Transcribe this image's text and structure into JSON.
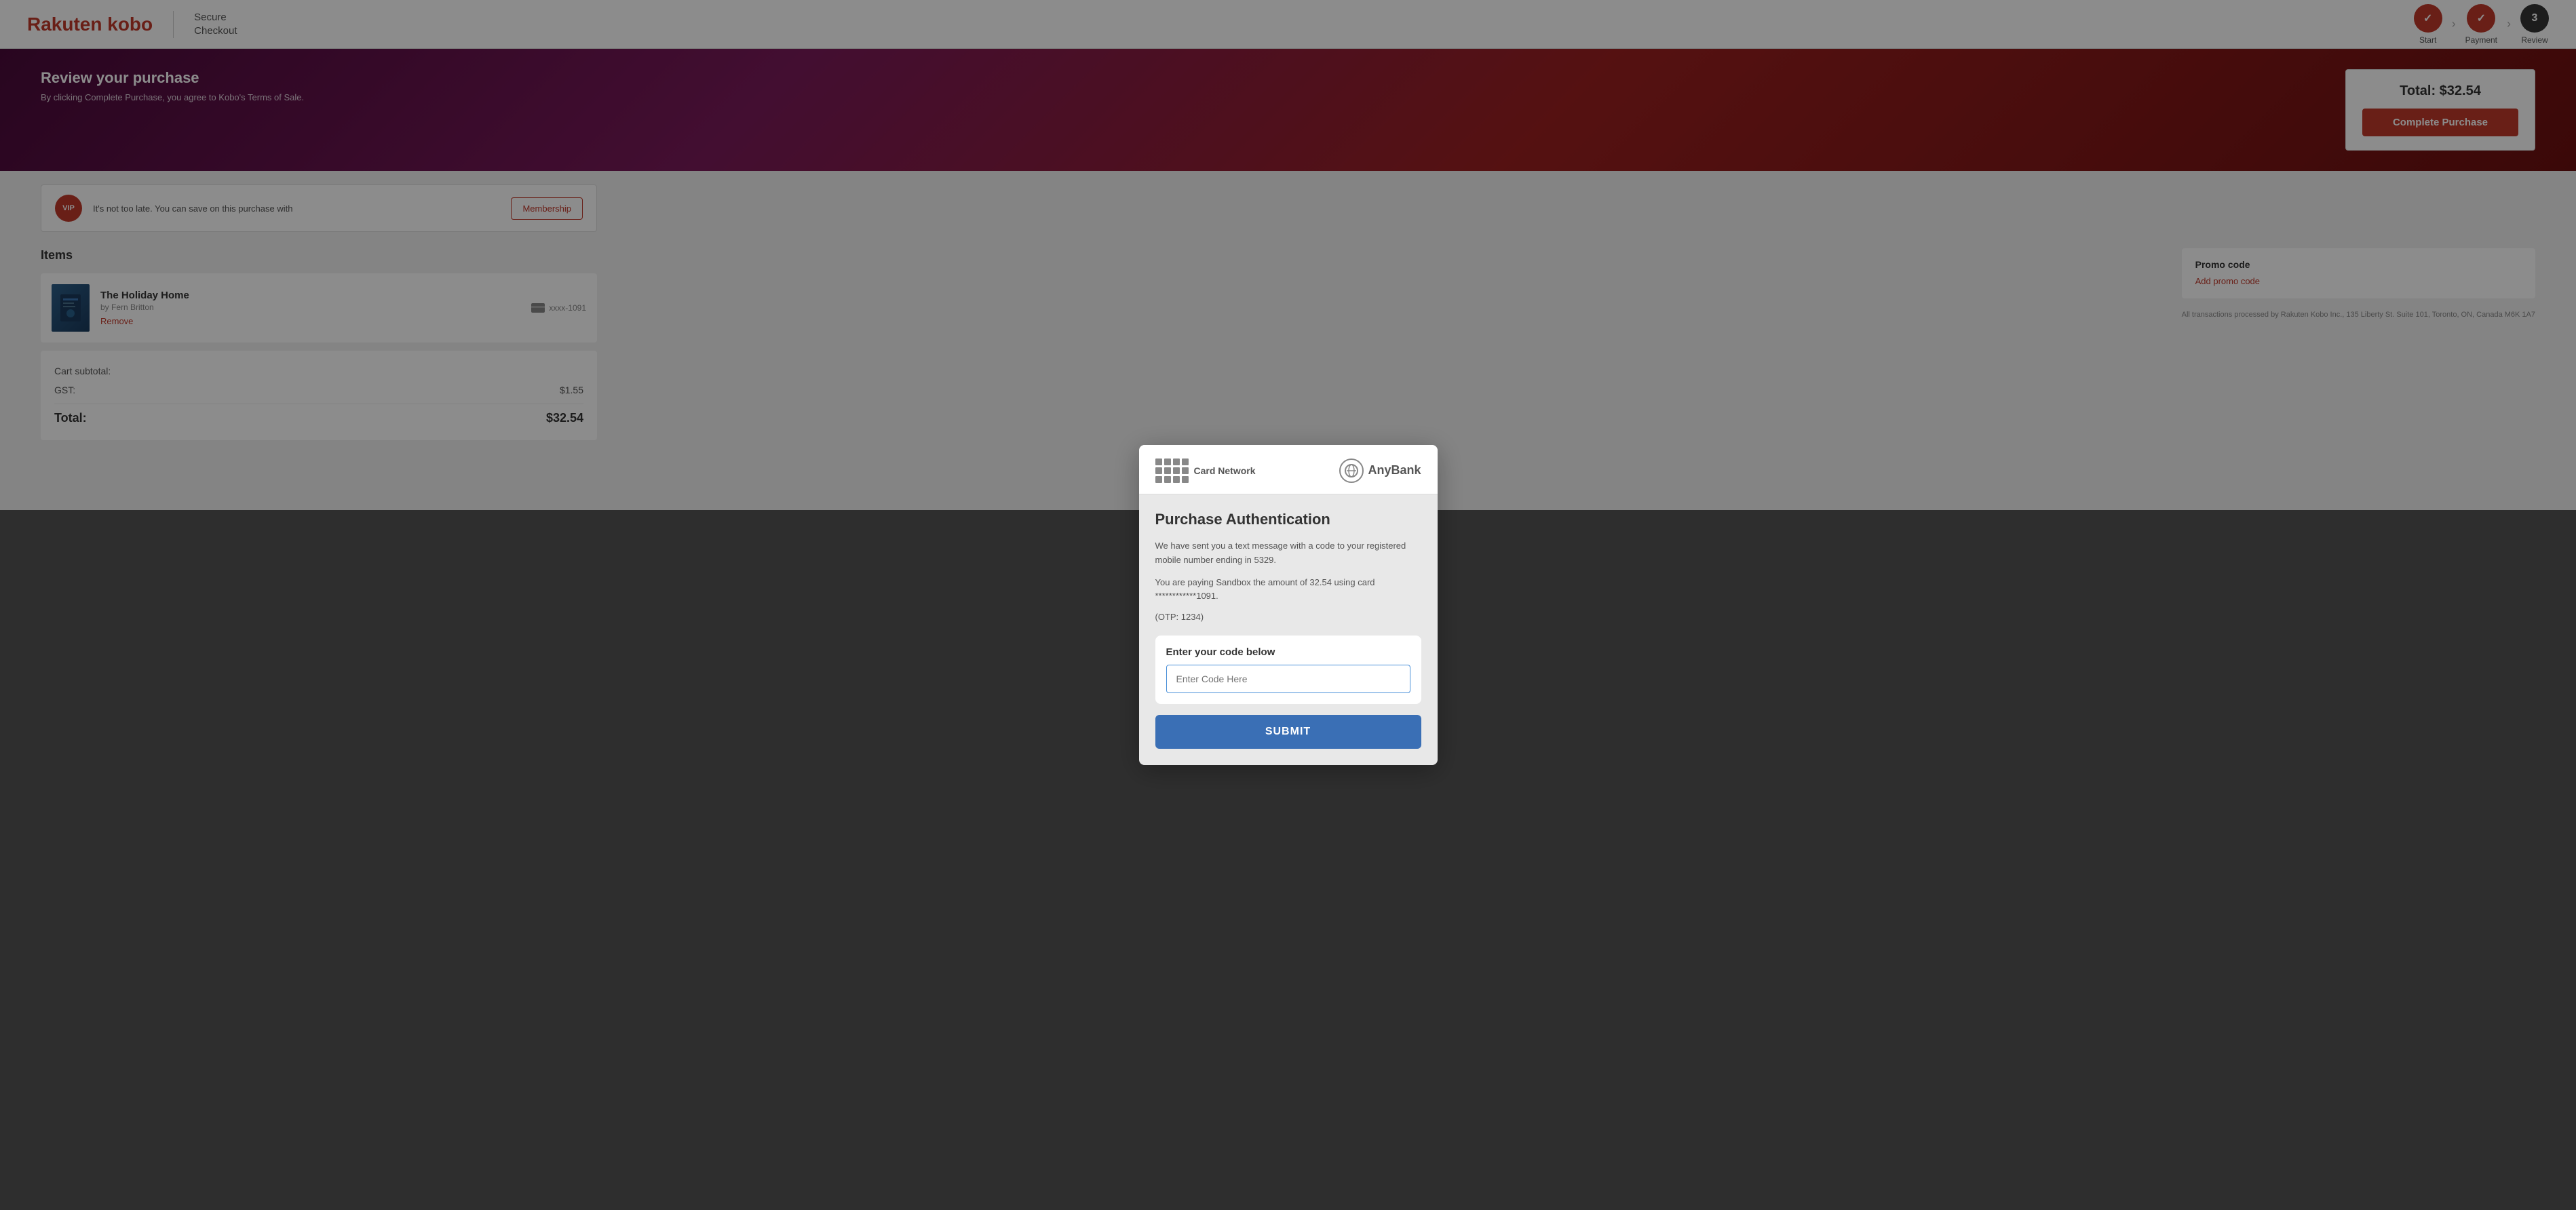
{
  "header": {
    "logo": "Rakuten kobo",
    "checkout_title": "Secure",
    "checkout_subtitle": "Checkout",
    "steps": [
      {
        "id": "start",
        "label": "Start",
        "state": "done",
        "number": "✓"
      },
      {
        "id": "payment",
        "label": "Payment",
        "state": "done",
        "number": "✓"
      },
      {
        "id": "review",
        "label": "Review",
        "state": "current",
        "number": "3"
      }
    ]
  },
  "hero": {
    "title": "Review your purchase",
    "subtitle": "By clicking Complete Purchase, you agree to Kobo's Terms of Sale.",
    "total_label": "Total: $32.54",
    "complete_btn": "Complete Purchase"
  },
  "vip": {
    "badge": "VIP",
    "text": "It's not too late. You can save on this purchase with",
    "btn": "Membership"
  },
  "items_section": {
    "title": "Items",
    "items": [
      {
        "id": "holiday-home",
        "title": "The Holiday Home",
        "author": "by Fern Britton",
        "remove": "Remove",
        "card": "xxxx-1091"
      }
    ]
  },
  "totals": {
    "subtotal_label": "Cart subtotal:",
    "gst_label": "GST:",
    "gst_value": "$1.55",
    "total_label": "Total:",
    "total_value": "$32.54"
  },
  "promo": {
    "title": "Promo code",
    "add_link": "Add promo code"
  },
  "footer_note": "All transactions processed by Rakuten Kobo Inc., 135 Liberty St. Suite 101, Toronto, ON, Canada M6K 1A7",
  "modal": {
    "card_network_label": "Card Network",
    "anybank_label": "AnyBank",
    "title": "Purchase Authentication",
    "desc1": "We have sent you a text message with a code to your registered mobile number ending in 5329.",
    "desc2": "You are paying Sandbox the amount of 32.54 using card ************1091.",
    "otp": "(OTP: 1234)",
    "code_section_title": "Enter your code below",
    "code_placeholder": "Enter Code Here",
    "submit_btn": "SUBMIT"
  }
}
